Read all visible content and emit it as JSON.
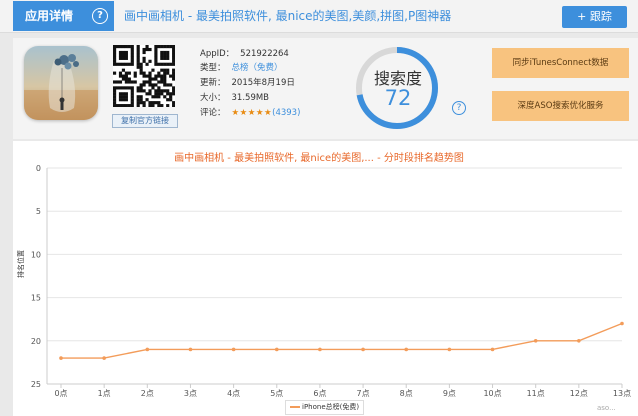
{
  "header": {
    "tab_label": "应用详情",
    "help_glyph": "?",
    "app_title": "画中画相机 - 最美拍照软件, 最nice的美图,美颜,拼图,P图神器",
    "follow_label": "+ 跟踪"
  },
  "app_info": {
    "copy_link_label": "复制官方链接",
    "appid_label": "AppID：",
    "appid": "521922264",
    "type_label": "类型：",
    "type": "总榜（免费）",
    "updated_label": "更新：",
    "updated": "2015年8月19日",
    "size_label": "大小：",
    "size": "31.59MB",
    "rating_label": "评论：",
    "stars": "★★★★★",
    "rating_count": "(4393)"
  },
  "gauge": {
    "title": "搜索度",
    "value": "72",
    "fraction": 0.72,
    "help_glyph": "?"
  },
  "actions": {
    "sync_label": "同步iTunesConnect数据",
    "aso_label": "深度ASO搜索优化服务"
  },
  "chart_data": {
    "type": "line",
    "title": "画中画相机 - 最美拍照软件, 最nice的美图,... - 分时段排名趋势图",
    "ylabel": "排名位置",
    "xlabel": "",
    "ylim": [
      0,
      25
    ],
    "y_reversed": true,
    "y_ticks": [
      "0",
      "5",
      "10",
      "15",
      "20",
      "25"
    ],
    "categories": [
      "0点",
      "1点",
      "2点",
      "3点",
      "4点",
      "5点",
      "6点",
      "7点",
      "8点",
      "9点",
      "10点",
      "11点",
      "12点",
      "13点"
    ],
    "series": [
      {
        "name": "iPhone总榜(免费)",
        "values": [
          22,
          22,
          21,
          21,
          21,
          21,
          21,
          21,
          21,
          21,
          21,
          20,
          20,
          18
        ]
      }
    ],
    "color": "#f39c5a",
    "grid": true,
    "legend": "bottom-center"
  },
  "watermark": "aso..."
}
